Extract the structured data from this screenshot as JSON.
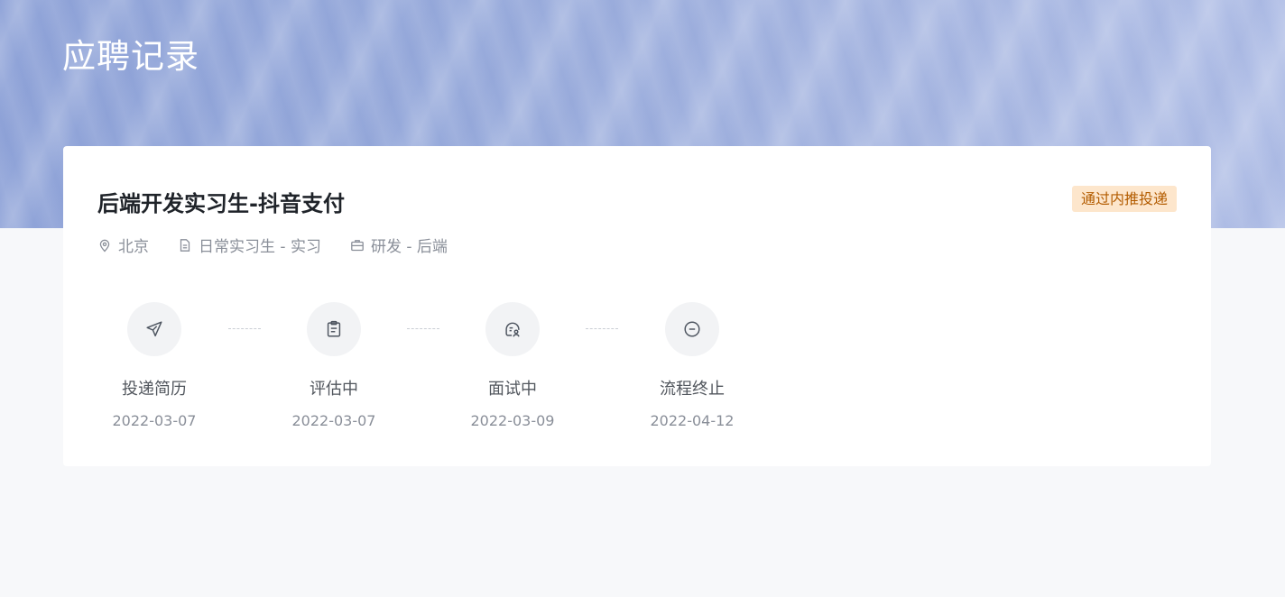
{
  "page": {
    "title": "应聘记录"
  },
  "application": {
    "job_title": "后端开发实习生-抖音支付",
    "status_badge": "通过内推投递",
    "location": "北京",
    "job_type": "日常实习生 - 实习",
    "category": "研发 - 后端"
  },
  "steps": [
    {
      "label": "投递简历",
      "date": "2022-03-07",
      "icon": "paper-plane-icon"
    },
    {
      "label": "评估中",
      "date": "2022-03-07",
      "icon": "clipboard-icon"
    },
    {
      "label": "面试中",
      "date": "2022-03-09",
      "icon": "interview-icon"
    },
    {
      "label": "流程终止",
      "date": "2022-04-12",
      "icon": "minus-circle-icon"
    }
  ],
  "colors": {
    "badge_bg": "#fde6cc",
    "badge_text": "#b35c00",
    "hero": "#97aadb"
  }
}
